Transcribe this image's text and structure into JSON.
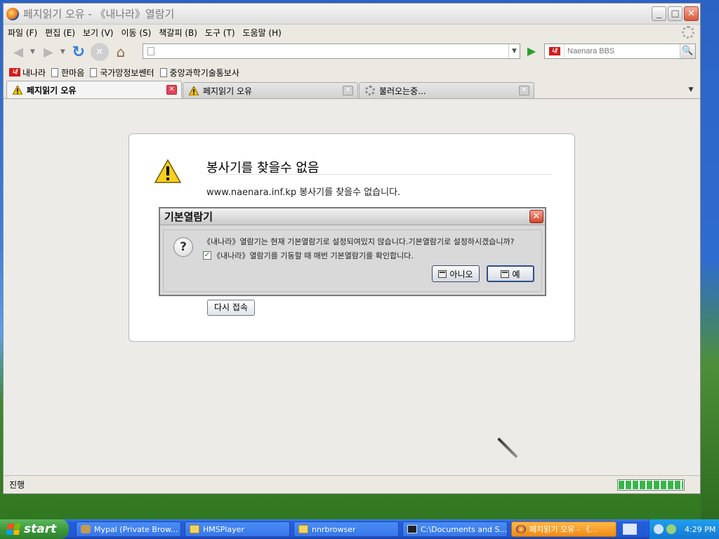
{
  "window": {
    "title": "페지읽기 오유 - 《내나라》열람기",
    "controls": {
      "minimize": "_",
      "maximize": "□",
      "close": "✕"
    }
  },
  "menu": [
    "파일 (F)",
    "편집 (E)",
    "보기 (V)",
    "이동 (S)",
    "책갈피 (B)",
    "도구 (T)",
    "도움말 (H)"
  ],
  "navigation": {
    "url_value": "",
    "search_placeholder": "Naenara BBS",
    "search_engine_logo": "내",
    "icons": [
      "back-icon",
      "forward-icon",
      "reload-icon",
      "stop-icon",
      "home-icon"
    ]
  },
  "bookmarks": [
    {
      "label": "내나라",
      "icon": "naenara-logo-icon"
    },
    {
      "label": "한마음",
      "icon": "page-icon"
    },
    {
      "label": "국가망정보쎈터",
      "icon": "page-icon"
    },
    {
      "label": "중앙과학기술통보사",
      "icon": "page-icon"
    }
  ],
  "tabs": [
    {
      "label": "페지읽기 오유",
      "icon": "warning-icon",
      "active": true
    },
    {
      "label": "페지읽기 오유",
      "icon": "warning-icon",
      "active": false
    },
    {
      "label": "불러오는중...",
      "icon": "loading-icon",
      "active": false
    }
  ],
  "error_page": {
    "title": "봉사기를 찾을수 없음",
    "description": "www.naenara.inf.kp 봉사기를 찾을수 없습니다.",
    "retry_label": "다시 접속"
  },
  "dialog": {
    "title": "기본열람기",
    "message": "《내나라》열람기는 현재 기본열람기로 설정되여있지 않습니다.기본열람기로 설정하시겠습니까?",
    "checkbox_label": "《내나라》열람기를 기동할 때 매번 기본열람기를 확인합니다.",
    "checkbox_checked": true,
    "no_label": "아니오",
    "yes_label": "예"
  },
  "status": {
    "text": "진행",
    "progress": 1.0
  },
  "taskbar": {
    "start_label": "start",
    "tasks": [
      {
        "label": "Mypal (Private Brow...",
        "icon": "mypal-icon",
        "active": false
      },
      {
        "label": "HMSPlayer",
        "icon": "folder-icon",
        "active": false
      },
      {
        "label": "nnrbrowser",
        "icon": "folder-icon",
        "active": false
      },
      {
        "label": "C:\\Documents and S...",
        "icon": "7zip-icon",
        "active": false
      },
      {
        "label": "페지읽기 오유 - 《...",
        "icon": "naenara-browser-icon",
        "active": true
      }
    ],
    "clock": "4:29 PM"
  },
  "colors": {
    "accent_active_task": "#f08a13",
    "tab_close_active": "#e0455a",
    "progress_green": "#39b54a",
    "dialog_close": "#d3442a"
  }
}
